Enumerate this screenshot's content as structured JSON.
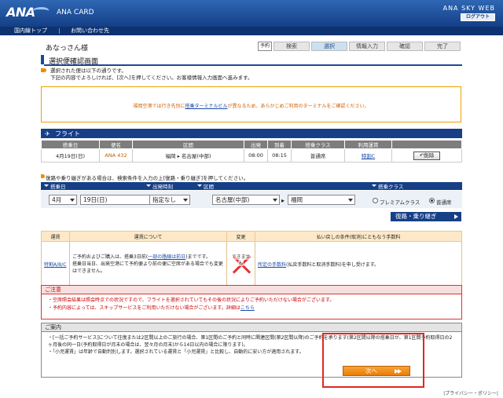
{
  "header": {
    "logo": "ANA",
    "title": "ANA CARD",
    "brand": "ANA SKY WEB",
    "logout": "ログアウト"
  },
  "nav": {
    "items": [
      "国内線トップ",
      "お問い合わせ先"
    ]
  },
  "greeting": "あなっさん様",
  "steps": {
    "first": "予約",
    "items": [
      "検索",
      "選択",
      "情報入力",
      "確認",
      "完了"
    ]
  },
  "page_title": "選択便確認画面",
  "notice": {
    "line1": "選択された便は以下の通りです。",
    "line2": "下記の内容でよろしければ、[次へ]を押してください。お客様情報入力画面へ進みます。"
  },
  "info_box": {
    "pre": "福岡空港では行き先別に",
    "link": "搭乗ターミナルビル",
    "post": "が異なるため、あらかじめご利用のターミナルをご確認ください。"
  },
  "flight": {
    "section_label": "フライト",
    "headers": [
      "搭乗日",
      "便名",
      "区間",
      "出発",
      "到着",
      "搭乗クラス",
      "利用運賃",
      ""
    ],
    "row": {
      "date": "4月19日(日)",
      "flight_no": "ANA 432",
      "from": "福岡",
      "to": "名古屋(中部)",
      "dep": "08:00",
      "arr": "08:15",
      "class": "普通席",
      "fare": "特割C",
      "delete": "削除"
    }
  },
  "search": {
    "note": "復路や乗り継ぎがある場合は、検索条件を入力の上[復路・乗り継ぎ]を押してください。",
    "labels": {
      "date": "搭乗日",
      "time": "出発時刻",
      "route": "区間",
      "class": "搭乗クラス"
    },
    "month": "4月",
    "day": "19日(日)",
    "time": "指定なし",
    "from": "名古屋(中部)",
    "to": "福岡",
    "class_premium": "プレミアムクラス",
    "class_normal": "普通席"
  },
  "multi_button": "復路・乗り継ぎ",
  "fare_table": {
    "headers": [
      "運賃",
      "運賃について",
      "変更",
      "払い戻しの条件(取消)にともなう手数料"
    ],
    "fare": "特割A/B/C",
    "about_1": "ご予約およびご購入は、搭乗3日前(",
    "about_link": "一部の路線は前日",
    "about_2": ")までです。",
    "about_3": "搭乗日当日、出発空港にて予約便より前の便に空席がある場合でも変更はできません。",
    "change_label": "できません",
    "refund_link": "所定の手数料",
    "refund_text": "(払戻手数料と取消手数料)を申し受けます。"
  },
  "caution": {
    "title": "ご注意",
    "items": [
      "空席照会結果は照会時点での状況ですので、フライトを選択されていてもその後の状況によりご予約いただけない場合がございます。",
      "予約内容によっては、スキップサービスをご利用いただけない場合がございます。詳細は",
      "こちら"
    ]
  },
  "guide": {
    "title": "ご案内",
    "items": [
      "[一括ご予約サービス]について往復または2区間以上のご旅行の場合、第1区間のご予約と同時に関連区間(第2区間以降)のご予約を承ります(第2区間以降の搭乗日が、第1区間予約取得日の2ヶ月後の同一日(予約取得日が月末の場合は、翌々月の月末)から14日以内の場合に限ります)。",
      "「小児運賃」は年齢で自動判別します。選択されている運賃と「小児運賃」と比較し、自動的に安い方が適用されます。"
    ]
  },
  "next_button": "次へ",
  "footer": "|プライバシー・ポリシー|"
}
